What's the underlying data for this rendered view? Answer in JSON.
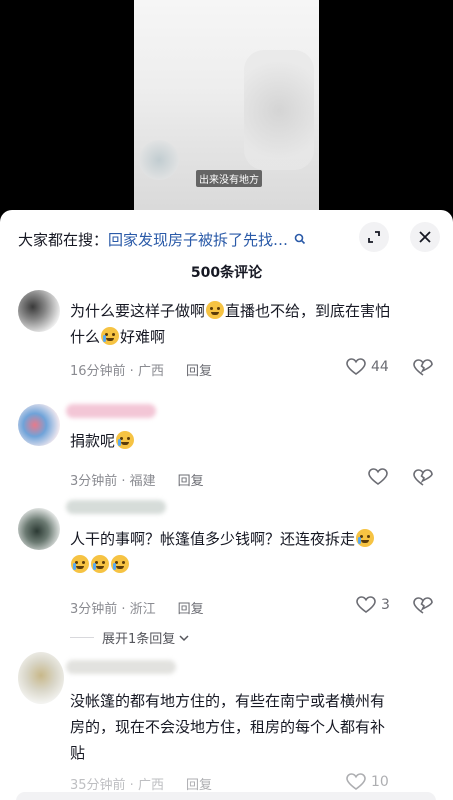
{
  "video": {
    "caption": "出来没有地方"
  },
  "header": {
    "search_prefix": "大家都在搜：",
    "search_query": "回家发现房子被拆了先找…",
    "icons": {
      "search": "search-icon",
      "expand": "expand-icon",
      "close": "close-icon"
    }
  },
  "comments_count": "500条评论",
  "comments": [
    {
      "text_line1": "为什么要这样子做啊",
      "text_line1b": "直播也不给，到底在害怕",
      "text_line2": "什么",
      "text_line2b": "好难啊",
      "meta": "16分钟前 · 广西",
      "reply": "回复",
      "likes": "44"
    },
    {
      "text_line1": "捐款呢",
      "meta": "3分钟前 · 福建",
      "reply": "回复",
      "likes": ""
    },
    {
      "text_line1": "人干的事啊？帐篷值多少钱啊？还连夜拆走",
      "meta": "3分钟前 · 浙江",
      "reply": "回复",
      "likes": "3",
      "expand": "展开1条回复"
    },
    {
      "text_line1": "没帐篷的都有地方住的，有些在南宁或者横州有",
      "text_line2": "房的，现在不会没地方住，租房的每个人都有补",
      "text_line3": "贴",
      "meta": "35分钟前 · 广西",
      "reply": "回复",
      "likes": "10"
    }
  ],
  "colors": {
    "link": "#2a5aa8",
    "meta": "#8a8b91",
    "emoji": "#f6c343"
  }
}
